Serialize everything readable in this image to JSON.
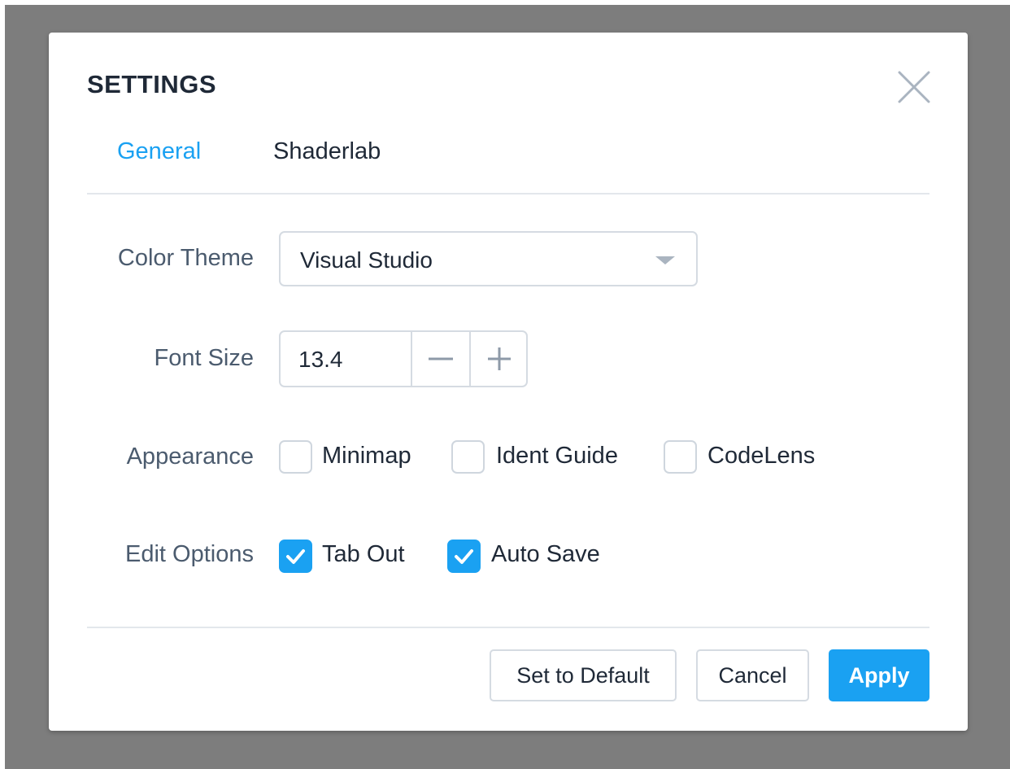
{
  "dialog": {
    "title": "SETTINGS",
    "close_icon": "close-icon"
  },
  "tabs": [
    {
      "label": "General",
      "active": true
    },
    {
      "label": "Shaderlab",
      "active": false
    }
  ],
  "color_theme": {
    "label": "Color Theme",
    "value": "Visual Studio",
    "icon": "caret-down-icon"
  },
  "font_size": {
    "label": "Font Size",
    "value": "13.4",
    "decrement_icon": "minus-icon",
    "increment_icon": "plus-icon"
  },
  "appearance": {
    "label": "Appearance",
    "options": [
      {
        "label": "Minimap",
        "checked": false
      },
      {
        "label": "Ident Guide",
        "checked": false
      },
      {
        "label": "CodeLens",
        "checked": false
      }
    ]
  },
  "edit_options": {
    "label": "Edit Options",
    "options": [
      {
        "label": "Tab Out",
        "checked": true,
        "icon": "checkmark-icon"
      },
      {
        "label": "Auto Save",
        "checked": true,
        "icon": "checkmark-icon"
      }
    ]
  },
  "footer": {
    "set_default_label": "Set to Default",
    "cancel_label": "Cancel",
    "apply_label": "Apply"
  },
  "colors": {
    "accent": "#1aa1f2",
    "backdrop": "#7d7d7d",
    "label_text": "#4b5b6e",
    "border": "#d5dbe2"
  }
}
